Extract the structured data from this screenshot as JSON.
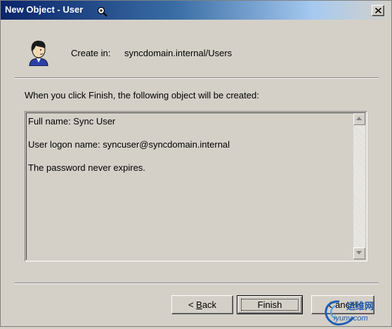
{
  "window": {
    "title": "New Object - User"
  },
  "header": {
    "create_in_label": "Create in:",
    "create_in_path": "syncdomain.internal/Users",
    "icon": "user-icon"
  },
  "intro_text": "When you click Finish, the following object will be created:",
  "summary": {
    "lines": [
      "Full name: Sync User",
      "User logon name: syncuser@syncdomain.internal",
      "The password never expires."
    ]
  },
  "buttons": {
    "back_prefix": "< ",
    "back_mnemonic": "B",
    "back_rest": "ack",
    "finish": "Finish",
    "cancel": "Cancel"
  },
  "watermark": {
    "text": "运维网",
    "subtext": "iyunv.com"
  },
  "colors": {
    "title_start": "#0a246a",
    "title_end": "#a6caf0",
    "face": "#d4d0c8"
  }
}
